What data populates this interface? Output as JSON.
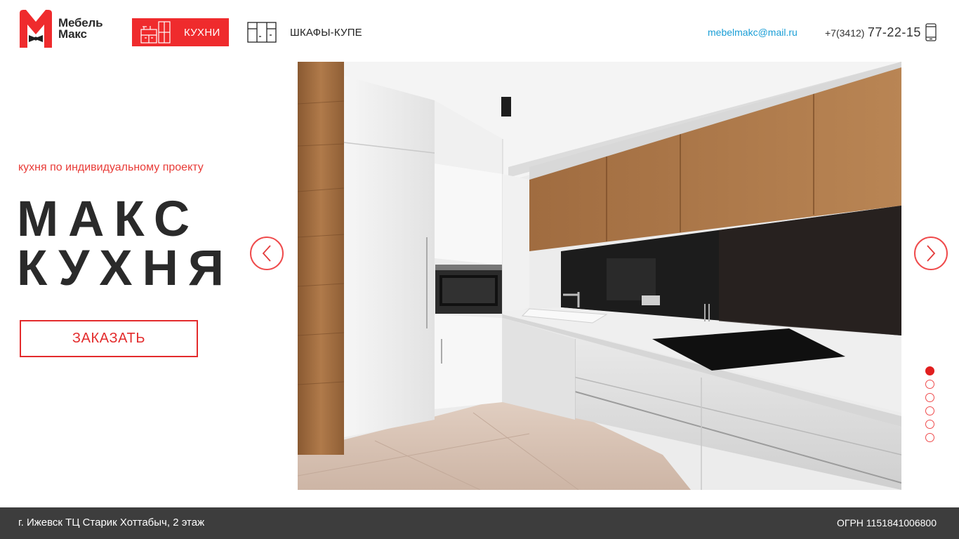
{
  "brand": {
    "logo_text_line1": "Мебель",
    "logo_text_line2": "Макс",
    "logo_letter": "M",
    "accent_color": "#ef2b2d"
  },
  "nav": {
    "items": [
      {
        "label": "КУХНИ",
        "icon": "kitchen-cabinet-icon",
        "active": true
      },
      {
        "label": "ШКАФЫ-КУПЕ",
        "icon": "wardrobe-icon",
        "active": false
      }
    ]
  },
  "contacts": {
    "email": "mebelmakc@mail.ru",
    "phone_code": "+7(3412)",
    "phone_number": "77-22-15",
    "phone_icon": "smartphone-icon"
  },
  "hero": {
    "tagline": "кухня по индивидуальному проекту",
    "title_line1": "МАКС",
    "title_line2": "КУХНЯ",
    "order_button": "ЗАКАЗАТЬ"
  },
  "slider": {
    "prev_icon": "chevron-left-icon",
    "next_icon": "chevron-right-icon",
    "slide_count": 6,
    "active_slide": 1
  },
  "footer": {
    "address": "г. Ижевск ТЦ Старик Хоттабыч, 2 этаж",
    "ogrn": "ОГРН 1151841006800"
  }
}
